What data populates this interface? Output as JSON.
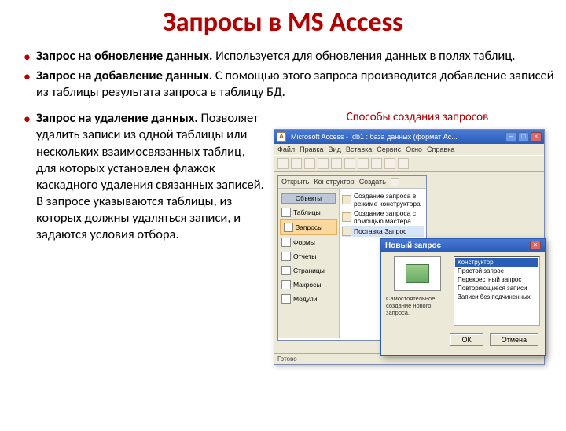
{
  "title": "Запросы в MS Access",
  "top_bullets": [
    {
      "bold": "Запрос на обновление данных.",
      "rest": " Используется для обновления данных в полях таблиц."
    },
    {
      "bold": "Запрос на добавление данных.",
      "rest": " С помощью этого запроса производится добавление записей из таблицы результата запроса в таблицу БД."
    }
  ],
  "left_bullet": {
    "bold": "Запрос на удаление данных.",
    "rest": " Позволяет удалить записи из одной таблицы или нескольких взаимосвязанных таблиц, для которых установлен флажок каскадного удаления связанных записей. В запросе указываются таблицы, из которых должны удаляться записи, и задаются условия отбора."
  },
  "right_subtitle": "Способы создания запросов",
  "access_window": {
    "title": "Microsoft Access - [db1 : база данных (формат Ac...",
    "menu": [
      "Файл",
      "Правка",
      "Вид",
      "Вставка",
      "Сервис",
      "Окно",
      "Справка"
    ],
    "db_toolbar": [
      "Открыть",
      "Конструктор",
      "Создать"
    ],
    "nav_header": "Объекты",
    "nav_items": [
      "Таблицы",
      "Запросы",
      "Формы",
      "Отчеты",
      "Страницы",
      "Макросы",
      "Модули"
    ],
    "nav_active_index": 1,
    "content_options": [
      "Создание запроса в режиме конструктора",
      "Создание запроса с помощью мастера",
      "Поставка Запрос"
    ],
    "status": "Готово"
  },
  "dialog": {
    "title": "Новый запрос",
    "left_text": "Самостоятельное создание нового запроса.",
    "list": [
      "Конструктор",
      "Простой запрос",
      "Перекрестный запрос",
      "Повторяющиеся записи",
      "Записи без подчиненных"
    ],
    "selected_index": 0,
    "buttons": {
      "ok": "ОК",
      "cancel": "Отмена"
    }
  }
}
